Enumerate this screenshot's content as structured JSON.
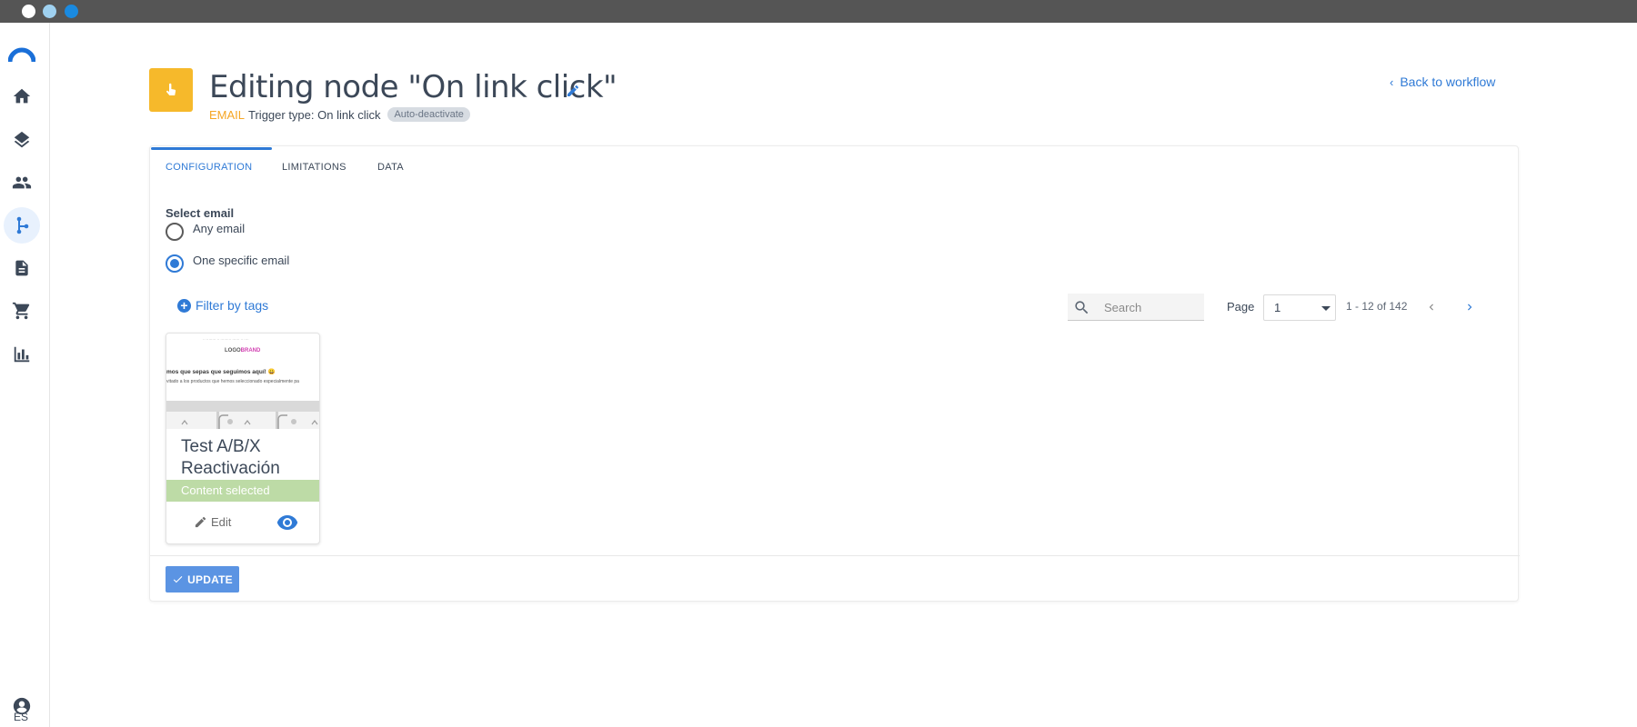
{
  "page": {
    "title": "Editing node \"On link click\"",
    "channel": "EMAIL",
    "trigger": "Trigger type: On link click",
    "badge": "Auto-deactivate",
    "back_link": "Back to workflow"
  },
  "sidebar": {
    "items": [
      {
        "icon": "brand-logo-icon",
        "active": false
      },
      {
        "icon": "home-icon",
        "active": false
      },
      {
        "icon": "layers-icon",
        "active": false
      },
      {
        "icon": "people-icon",
        "active": false
      },
      {
        "icon": "workflow-icon",
        "active": true
      },
      {
        "icon": "document-icon",
        "active": false
      },
      {
        "icon": "cart-icon",
        "active": false
      },
      {
        "icon": "bar-chart-icon",
        "active": false
      }
    ],
    "language": "ES"
  },
  "tabs": [
    {
      "label": "CONFIGURATION",
      "active": true
    },
    {
      "label": "LIMITATIONS",
      "active": false
    },
    {
      "label": "DATA",
      "active": false
    }
  ],
  "form": {
    "select_email_label": "Select email",
    "options": [
      {
        "label": "Any email",
        "selected": false
      },
      {
        "label": "One specific email",
        "selected": true
      }
    ]
  },
  "toolbar": {
    "filter_label": "Filter by tags",
    "search_placeholder": "Search",
    "page_label": "Page",
    "page_value": "1",
    "range_text": "1 - 12 of 142"
  },
  "email_card": {
    "title": "Test A/B/X Reactivación",
    "status": "Content selected",
    "edit_label": "Edit",
    "thumbnail": {
      "logo_a": "LOGO",
      "logo_b": "BRAND",
      "heading": "mos que sepas que seguimos aquí! 😀",
      "text": "vitado a los productos que hemos seleccionado especialmente pa"
    }
  },
  "actions": {
    "update_label": "UPDATE"
  },
  "colors": {
    "accent": "#2f7ad6",
    "node_icon": "#f6b92b",
    "channel": "#f6a623",
    "selected_bar": "#bddba6",
    "titlebar": "#555555"
  }
}
